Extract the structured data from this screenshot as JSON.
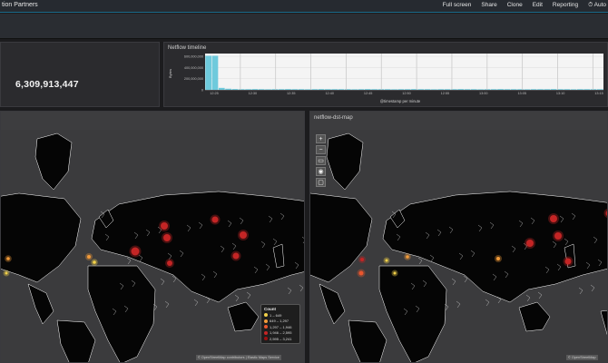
{
  "header": {
    "title": "tion Partners",
    "menu": [
      "Full screen",
      "Share",
      "Clone",
      "Edit",
      "Reporting",
      "⏱ Auto"
    ]
  },
  "metric_panel": {
    "value": "6,309,913,447"
  },
  "timeline_panel": {
    "title": "Netflow timeline",
    "ylabel": "Bytes",
    "xlabel": "@timestamp per minute",
    "chart_data": {
      "type": "bar",
      "title": "Netflow timeline",
      "ylabel": "Bytes",
      "xlabel": "@timestamp per minute",
      "ytick_labels": [
        "600,000,000",
        "400,000,000",
        "200,000,000",
        "0"
      ],
      "ylim": [
        0,
        650000000
      ],
      "xtick_labels": [
        "12:25",
        "12:30",
        "12:35",
        "12:40",
        "12:45",
        "12:50",
        "12:55",
        "13:00",
        "13:05",
        "13:10",
        "13:15"
      ],
      "values": [
        610000000,
        610000000,
        35000000,
        20000000,
        15000000,
        12000000,
        12000000,
        14000000,
        12000000,
        10000000,
        12000000,
        12000000,
        14000000,
        12000000,
        12000000,
        10000000,
        12000000,
        14000000,
        12000000,
        12000000,
        12000000,
        12000000,
        10000000,
        12000000,
        14000000,
        12000000,
        12000000,
        12000000,
        10000000,
        12000000,
        12000000,
        14000000,
        12000000,
        12000000,
        10000000,
        12000000,
        12000000,
        12000000,
        14000000,
        12000000,
        12000000,
        10000000,
        12000000,
        12000000,
        14000000,
        12000000,
        12000000,
        12000000,
        10000000,
        12000000,
        12000000,
        12000000,
        14000000,
        12000000,
        12000000,
        10000000,
        12000000,
        12000000,
        12000000,
        12000000
      ]
    }
  },
  "map_src": {
    "attribution": "© OpenStreetMap contributors | Elastic Maps Service",
    "legend": {
      "title": "Count",
      "rows": [
        {
          "label": "1 – 649",
          "color": "#f2d14a"
        },
        {
          "label": "649 – 1,297",
          "color": "#f29b3a"
        },
        {
          "label": "1,297 – 1,946",
          "color": "#e8562e"
        },
        {
          "label": "1,946 – 2,595",
          "color": "#c42525"
        },
        {
          "label": "2,595 – 3,241",
          "color": "#9b1010"
        }
      ]
    },
    "points": [
      {
        "x": 180,
        "y": 106,
        "r": 4,
        "color": "#c42525"
      },
      {
        "x": 236,
        "y": 99,
        "r": 3.5,
        "color": "#c42525"
      },
      {
        "x": 267,
        "y": 116,
        "r": 4,
        "color": "#c42525"
      },
      {
        "x": 183,
        "y": 119,
        "r": 4,
        "color": "#c42525"
      },
      {
        "x": 148,
        "y": 134,
        "r": 4.5,
        "color": "#c42525"
      },
      {
        "x": 186,
        "y": 147,
        "r": 3,
        "color": "#c42525"
      },
      {
        "x": 259,
        "y": 139,
        "r": 3.5,
        "color": "#c42525"
      },
      {
        "x": 97,
        "y": 140,
        "r": 2,
        "color": "#f29b3a"
      },
      {
        "x": 103,
        "y": 146,
        "r": 1.8,
        "color": "#f2d14a"
      },
      {
        "x": 8,
        "y": 142,
        "r": 1.8,
        "color": "#f29b3a"
      },
      {
        "x": 6,
        "y": 158,
        "r": 1.5,
        "color": "#f2d14a"
      }
    ]
  },
  "map_dst": {
    "title": "netflow-dst-map",
    "attribution": "© OpenStreetMap",
    "points": [
      {
        "x": 268,
        "y": 98,
        "r": 4,
        "color": "#c42525"
      },
      {
        "x": 273,
        "y": 117,
        "r": 4,
        "color": "#c42525"
      },
      {
        "x": 242,
        "y": 125,
        "r": 4,
        "color": "#c42525"
      },
      {
        "x": 284,
        "y": 145,
        "r": 3.5,
        "color": "#c42525"
      },
      {
        "x": 329,
        "y": 92,
        "r": 3.5,
        "color": "#c42525"
      },
      {
        "x": 57,
        "y": 143,
        "r": 2,
        "color": "#c42525"
      },
      {
        "x": 84,
        "y": 144,
        "r": 1.5,
        "color": "#f2d14a"
      },
      {
        "x": 107,
        "y": 140,
        "r": 1.8,
        "color": "#f29b3a"
      },
      {
        "x": 56,
        "y": 158,
        "r": 2.5,
        "color": "#e8562e"
      },
      {
        "x": 93,
        "y": 158,
        "r": 1.5,
        "color": "#f2d14a"
      },
      {
        "x": 207,
        "y": 142,
        "r": 2,
        "color": "#f29b3a"
      }
    ]
  }
}
